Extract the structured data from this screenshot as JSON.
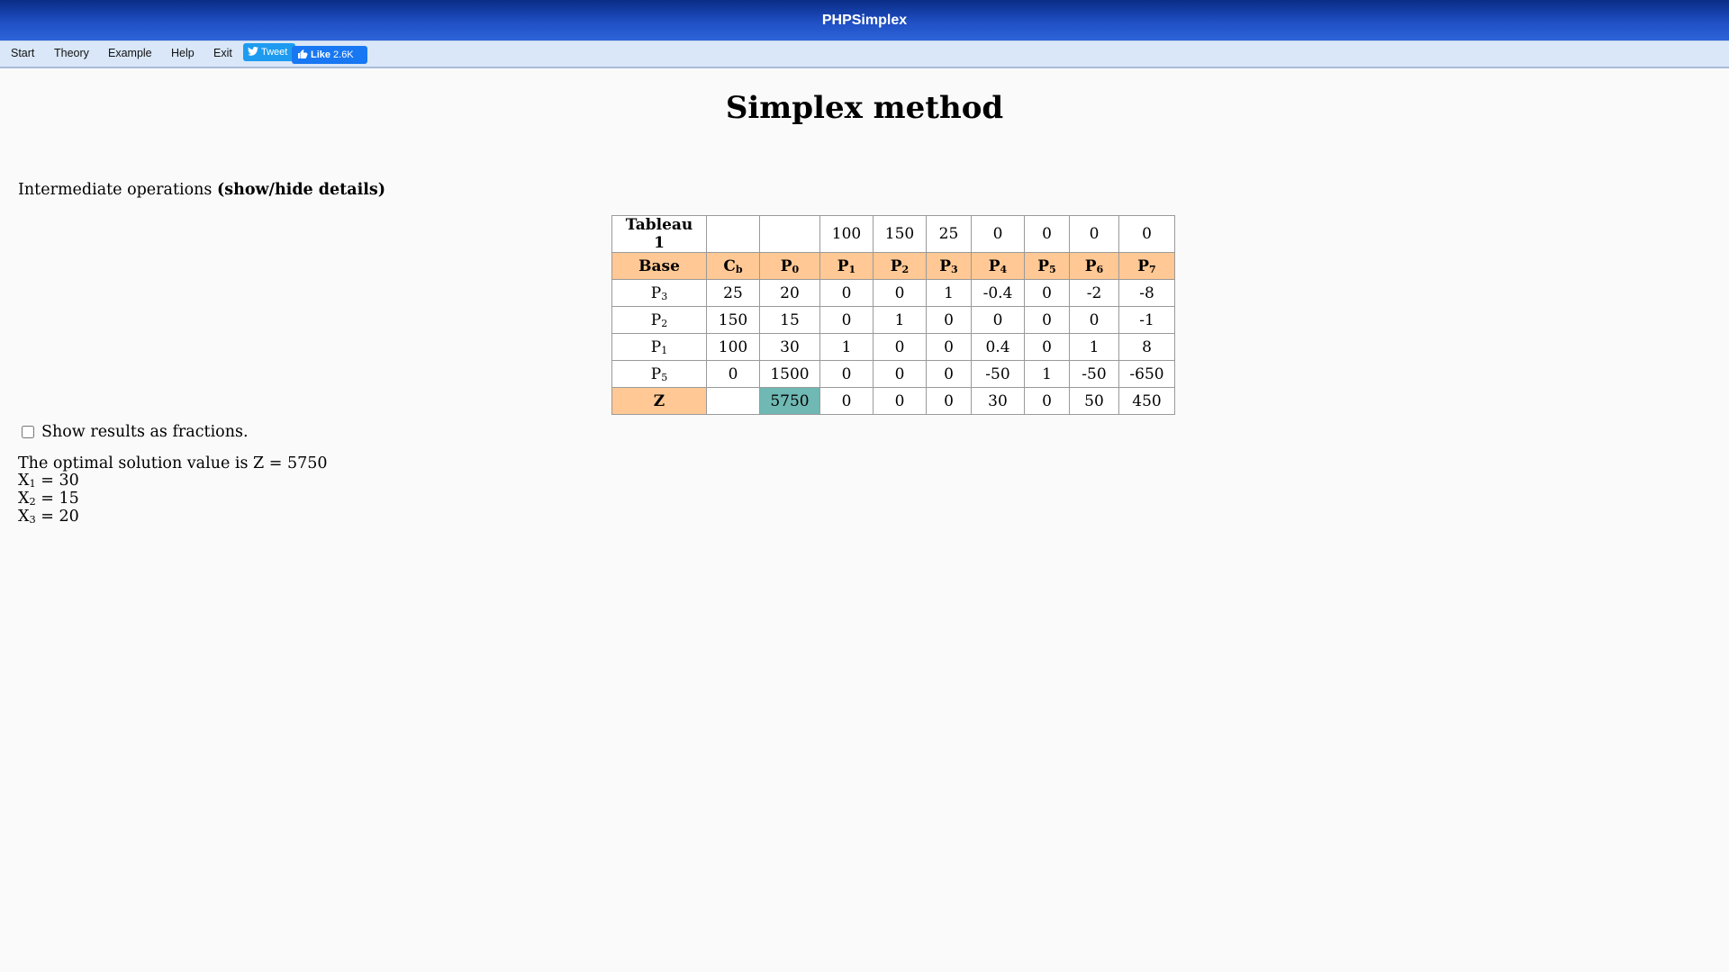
{
  "app": {
    "title": "PHPSimplex"
  },
  "menu": {
    "items": [
      "Start",
      "Theory",
      "Example",
      "Help",
      "Exit"
    ],
    "tweet_label": "Tweet",
    "like_label": "Like",
    "like_count": "2.6K",
    "tweet_icon": "twitter-bird-icon",
    "like_icon": "thumbs-up-icon"
  },
  "page": {
    "title": "Simplex method",
    "intermediate_prefix": "Intermediate operations",
    "intermediate_toggle": "(show/hide details)",
    "fractions_label": "Show results as fractions.",
    "fractions_checked": false
  },
  "tableau": {
    "name": "Tableau 1",
    "cost_row": [
      "",
      "",
      "100",
      "150",
      "25",
      "0",
      "0",
      "0",
      "0"
    ],
    "headers": [
      {
        "base": "P",
        "sub": ""
      },
      {
        "base": "C",
        "sub": "b"
      },
      {
        "base": "P",
        "sub": "0"
      },
      {
        "base": "P",
        "sub": "1"
      },
      {
        "base": "P",
        "sub": "2"
      },
      {
        "base": "P",
        "sub": "3"
      },
      {
        "base": "P",
        "sub": "4"
      },
      {
        "base": "P",
        "sub": "5"
      },
      {
        "base": "P",
        "sub": "6"
      },
      {
        "base": "P",
        "sub": "7"
      }
    ],
    "base_header": "Base",
    "rows": [
      {
        "var": "P",
        "sub": "3",
        "cells": [
          "25",
          "20",
          "0",
          "0",
          "1",
          "-0.4",
          "0",
          "-2",
          "-8"
        ]
      },
      {
        "var": "P",
        "sub": "2",
        "cells": [
          "150",
          "15",
          "0",
          "1",
          "0",
          "0",
          "0",
          "0",
          "-1"
        ]
      },
      {
        "var": "P",
        "sub": "1",
        "cells": [
          "100",
          "30",
          "1",
          "0",
          "0",
          "0.4",
          "0",
          "1",
          "8"
        ]
      },
      {
        "var": "P",
        "sub": "5",
        "cells": [
          "0",
          "1500",
          "0",
          "0",
          "0",
          "-50",
          "1",
          "-50",
          "-650"
        ]
      }
    ],
    "z_row": {
      "label": "Z",
      "cells": [
        "",
        "5750",
        "0",
        "0",
        "0",
        "30",
        "0",
        "50",
        "450"
      ]
    },
    "colors": {
      "header_bg": "#ffc894",
      "highlight_bg": "#6fb8b3"
    }
  },
  "solution": {
    "summary": "The optimal solution value is Z = 5750",
    "vars": [
      {
        "name": "X",
        "sub": "1",
        "value": "= 30"
      },
      {
        "name": "X",
        "sub": "2",
        "value": "= 15"
      },
      {
        "name": "X",
        "sub": "3",
        "value": "= 20"
      }
    ]
  }
}
